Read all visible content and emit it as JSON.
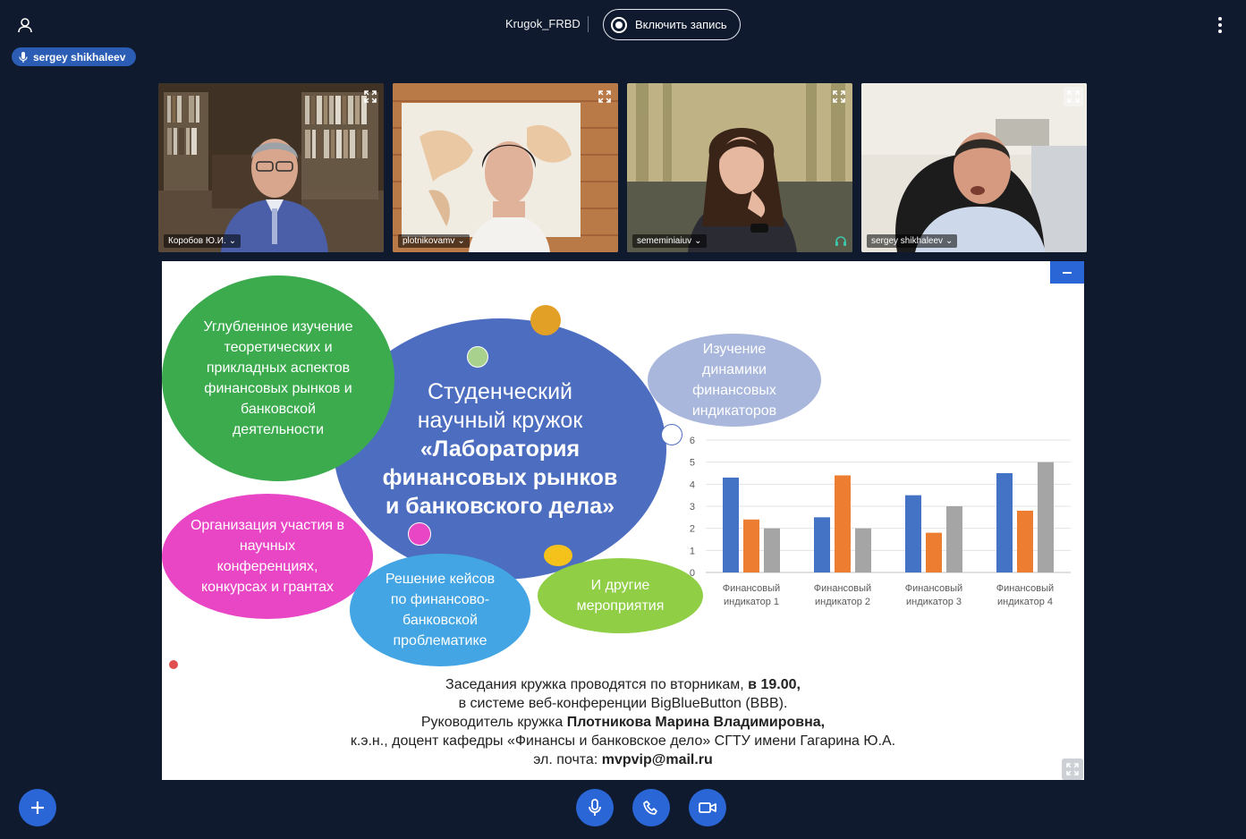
{
  "header": {
    "meeting_title": "Krugok_FRBD",
    "record_label": "Включить запись",
    "talking_user": "sergey shikhaleev"
  },
  "webcams": [
    {
      "name": "Коробов Ю.И.",
      "headset": false
    },
    {
      "name": "plotnikovamv",
      "headset": false
    },
    {
      "name": "sememiniaiuv",
      "headset": true
    },
    {
      "name": "sergey shikhaleev",
      "headset": false
    }
  ],
  "slide": {
    "title_lines": [
      "Студенческий",
      "научный кружок"
    ],
    "title_bold_lines": [
      "«Лаборатория",
      "финансовых рынков",
      "и банковского дела»"
    ],
    "bubbles": {
      "theory": "Углубленное изучение теоретических и прикладных аспектов финансовых рынков и банковской деятельности",
      "dynamics": "Изучение динамики финансовых индикаторов",
      "conferences": "Организация участия в научных конференциях, конкурсах и грантах",
      "cases": "Решение кейсов по финансово-банковской проблематике",
      "other": "И другие мероприятия"
    },
    "info": {
      "line1_normal": "Заседания кружка проводятся по вторникам, ",
      "line1_bold": "в 19.00,",
      "line2": "в системе веб-конференции BigBlueButton (BBB).",
      "line3_normal": "Руководитель кружка ",
      "line3_bold": "Плотникова Марина Владимировна,",
      "line4": "к.э.н., доцент кафедры «Финансы и банковское дело» СГТУ имени Гагарина Ю.А.",
      "line5_normal": "эл. почта: ",
      "line5_bold": "mvpvip@mail.ru"
    }
  },
  "chart_data": {
    "type": "bar",
    "categories": [
      "Финансовый индикатор 1",
      "Финансовый индикатор 2",
      "Финансовый индикатор 3",
      "Финансовый индикатор 4"
    ],
    "series": [
      {
        "values": [
          4.3,
          2.5,
          3.5,
          4.5
        ],
        "color": "#4472c4"
      },
      {
        "values": [
          2.4,
          4.4,
          1.8,
          2.8
        ],
        "color": "#ed7d31"
      },
      {
        "values": [
          2.0,
          2.0,
          3.0,
          5.0
        ],
        "color": "#a5a5a5"
      }
    ],
    "ylim": [
      0,
      6
    ],
    "yticks": [
      "0",
      "1",
      "2",
      "3",
      "4",
      "5",
      "6"
    ],
    "grid": true,
    "legend": "none"
  },
  "colors": {
    "background": "#0f1a2f",
    "accent": "#2a66d6"
  }
}
